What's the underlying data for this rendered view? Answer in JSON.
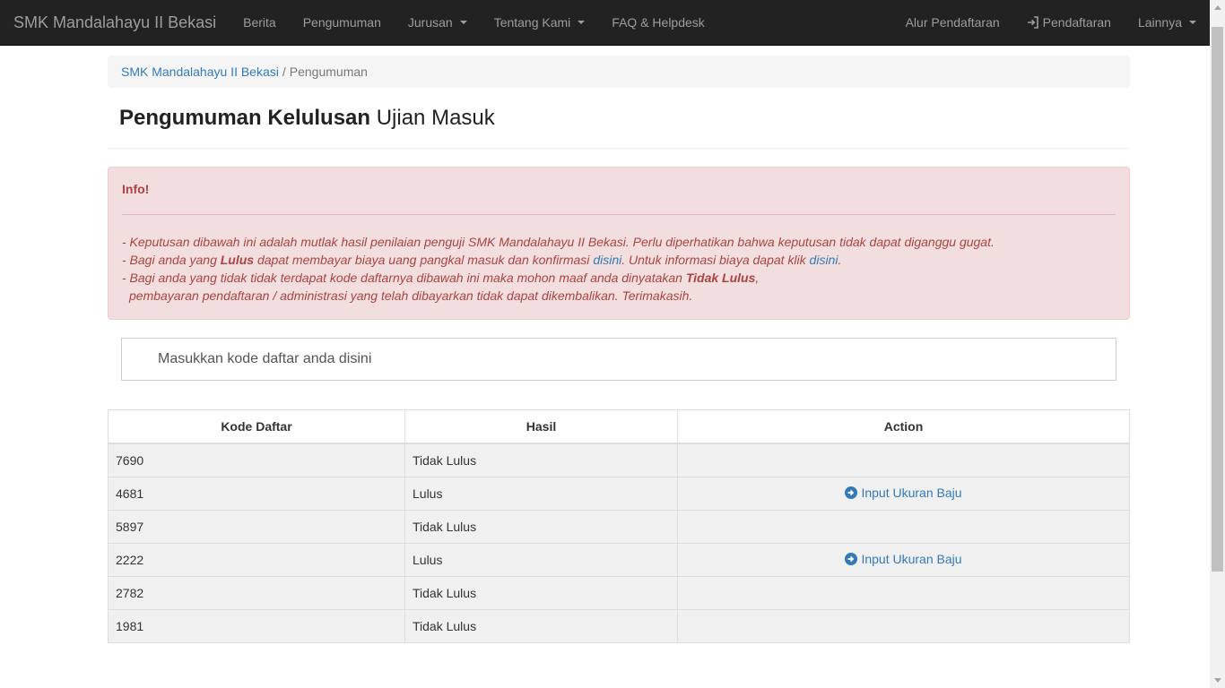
{
  "navbar": {
    "brand": "SMK Mandalahayu II Bekasi",
    "left": [
      {
        "label": "Berita",
        "dropdown": false
      },
      {
        "label": "Pengumuman",
        "dropdown": false
      },
      {
        "label": "Jurusan",
        "dropdown": true
      },
      {
        "label": "Tentang Kami",
        "dropdown": true
      },
      {
        "label": "FAQ & Helpdesk",
        "dropdown": false
      }
    ],
    "right": [
      {
        "label": "Alur Pendaftaran",
        "icon": null,
        "dropdown": false
      },
      {
        "label": "Pendaftaran",
        "icon": "login-icon",
        "dropdown": false
      },
      {
        "label": "Lainnya",
        "icon": null,
        "dropdown": true
      }
    ]
  },
  "breadcrumb": {
    "home": "SMK Mandalahayu II Bekasi",
    "separator": "/",
    "current": "Pengumuman"
  },
  "header": {
    "strong": "Pengumuman Kelulusan",
    "rest": " Ujian Masuk"
  },
  "alert": {
    "title": "Info!",
    "line1": "- Keputusan dibawah ini adalah mutlak hasil penilaian penguji SMK Mandalahayu II Bekasi. Perlu diperhatikan bahwa keputusan tidak dapat diganggu gugat.",
    "line2_a": "- Bagi anda yang ",
    "line2_bold": "Lulus",
    "line2_b": " dapat membayar biaya uang pangkal masuk dan konfirmasi ",
    "line2_link1": "disini",
    "line2_c": ". Untuk informasi biaya dapat klik ",
    "line2_link2": "disini",
    "line2_d": ".",
    "line3_a": "- Bagi anda yang tidak tidak terdapat kode daftarnya dibawah ini maka mohon maaf anda dinyatakan ",
    "line3_bold": "Tidak Lulus",
    "line3_b": ",",
    "line4": "pembayaran pendaftaran / administrasi yang telah dibayarkan tidak dapat dikembalikan. Terimakasih."
  },
  "search": {
    "placeholder": "Masukkan kode daftar anda disini"
  },
  "table": {
    "headers": [
      "Kode Daftar",
      "Hasil",
      "Action"
    ],
    "action_label": "Input Ukuran Baju",
    "rows": [
      {
        "kode": "7690",
        "hasil": "Tidak Lulus",
        "action": ""
      },
      {
        "kode": "4681",
        "hasil": "Lulus",
        "action": "Input Ukuran Baju"
      },
      {
        "kode": "5897",
        "hasil": "Tidak Lulus",
        "action": ""
      },
      {
        "kode": "2222",
        "hasil": "Lulus",
        "action": "Input Ukuran Baju"
      },
      {
        "kode": "2782",
        "hasil": "Tidak Lulus",
        "action": ""
      },
      {
        "kode": "1981",
        "hasil": "Tidak Lulus",
        "action": ""
      }
    ]
  },
  "colors": {
    "navbar_bg": "#222222",
    "navbar_text": "#9d9d9d",
    "link": "#337ab7",
    "alert_bg": "#f2dede",
    "alert_text": "#a94442"
  }
}
